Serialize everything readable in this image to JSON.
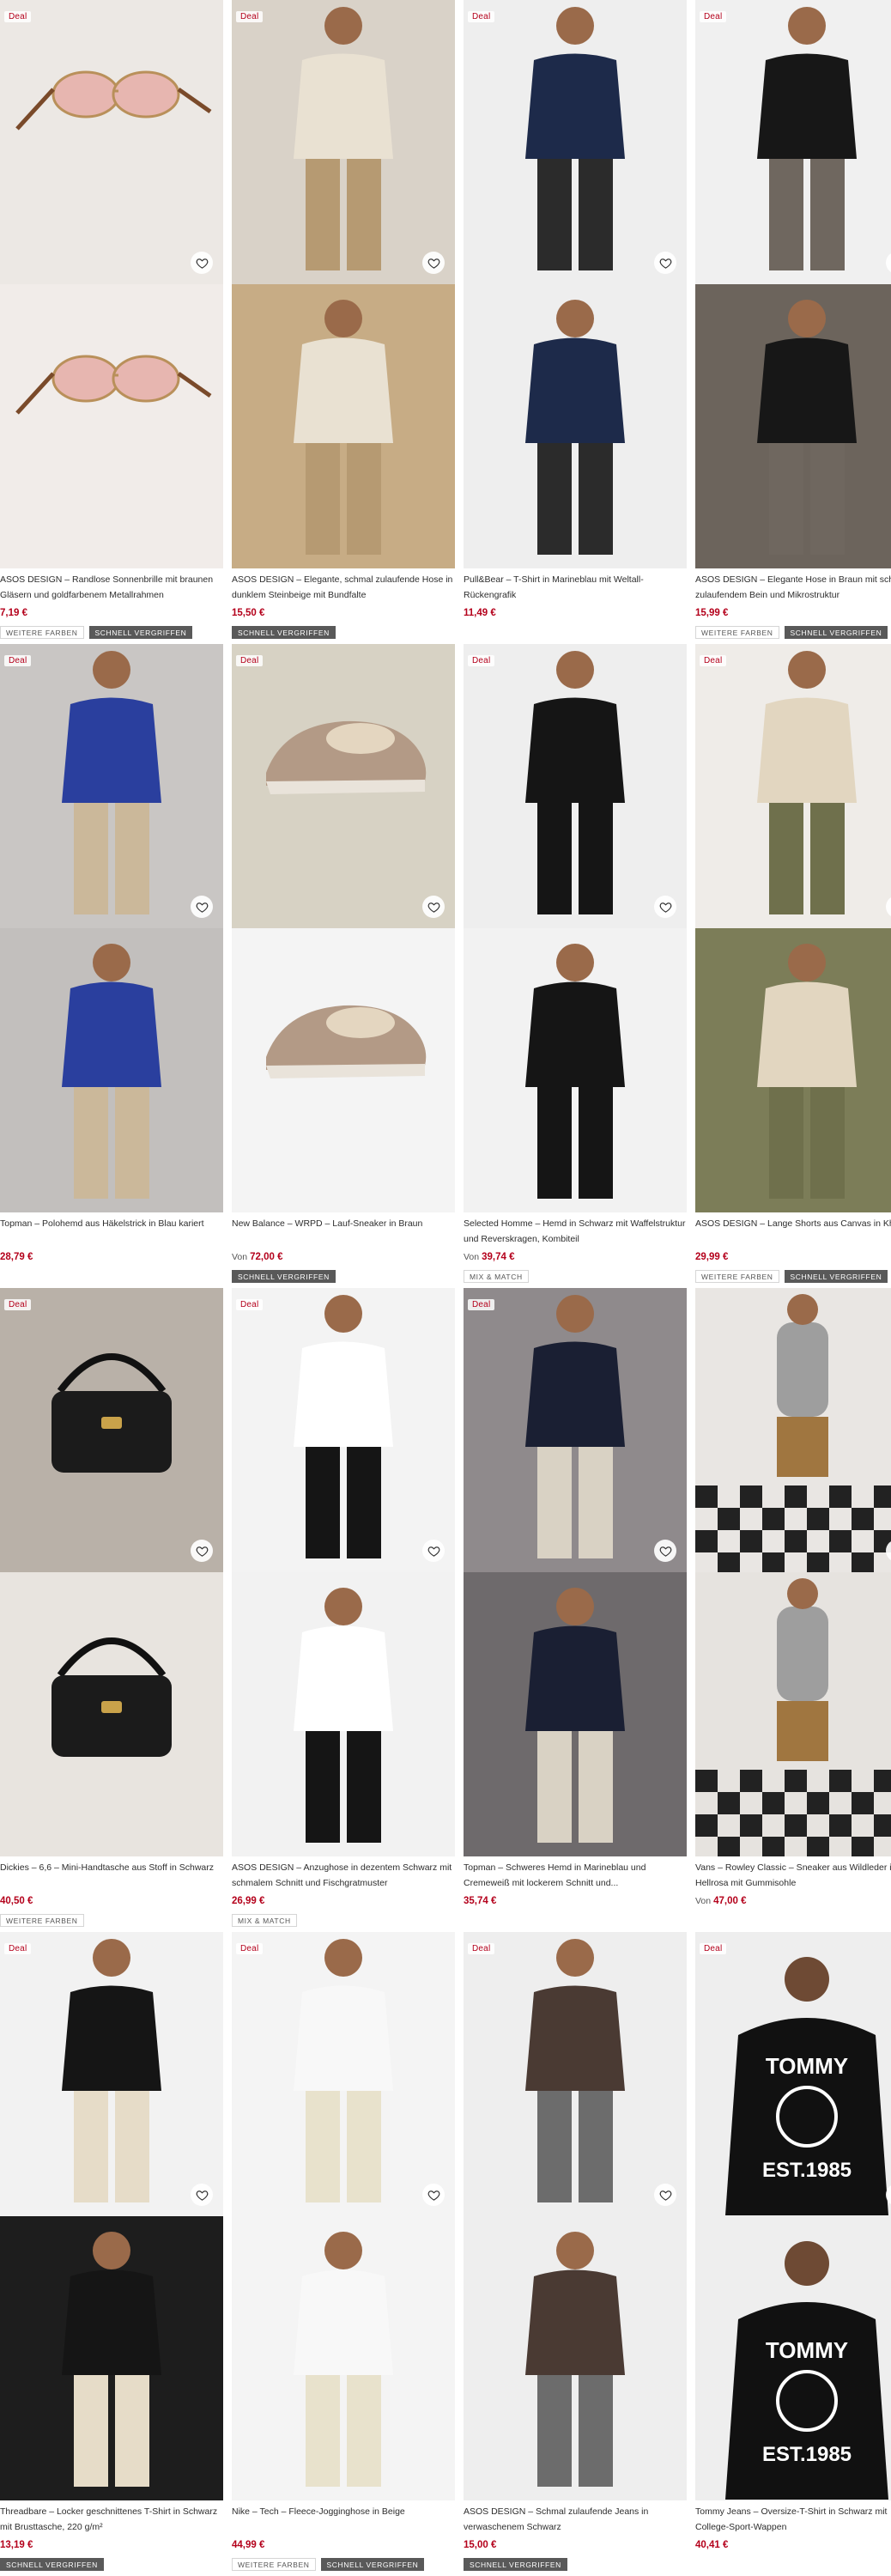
{
  "deal_label": "Deal",
  "colors": {
    "accent_price": "#b4001b",
    "badge_dark": "#595959"
  },
  "icons": {
    "wishlist": "heart-icon"
  },
  "products": [
    {
      "title": "ASOS DESIGN – Randlose Sonnenbrille mit braunen Gläsern und goldfarbenem Metallrahmen",
      "price": "7,19 €",
      "from": "",
      "deal": true,
      "badges": [
        {
          "label": "WEITERE FARBEN",
          "dark": false
        },
        {
          "label": "SCHNELL VERGRIFFEN",
          "dark": true
        }
      ],
      "top": "#ece8e4",
      "bottom": "#f1ece9",
      "figure": "sunglasses"
    },
    {
      "title": "ASOS DESIGN – Elegante, schmal zulaufende Hose in dunklem Steinbeige mit Bundfalte",
      "price": "15,50 €",
      "from": "",
      "deal": true,
      "badges": [
        {
          "label": "SCHNELL VERGRIFFEN",
          "dark": true
        }
      ],
      "top": "#d9d2c8",
      "bottom": "#c7ac85",
      "figure": "trousers"
    },
    {
      "title": "Pull&Bear – T-Shirt in Marineblau mit Weltall-Rückengrafik",
      "price": "11,49 €",
      "from": "",
      "deal": true,
      "badges": [],
      "top": "#eeeeee",
      "bottom": "#eeeeee",
      "figure": "navy-tee"
    },
    {
      "title": "ASOS DESIGN – Elegante Hose in Braun mit schmal zulaufendem Bein und Mikrostruktur",
      "price": "15,99 €",
      "from": "",
      "deal": true,
      "badges": [
        {
          "label": "WEITERE FARBEN",
          "dark": false
        },
        {
          "label": "SCHNELL VERGRIFFEN",
          "dark": true
        }
      ],
      "top": "#f0f0f0",
      "bottom": "#6c645c",
      "figure": "brown-trousers"
    },
    {
      "title": "Topman – Polohemd aus Häkelstrick in Blau kariert",
      "price": "28,79 €",
      "from": "",
      "deal": true,
      "badges": [],
      "top": "#c9c6c4",
      "bottom": "#c2bfbd",
      "figure": "blue-polo"
    },
    {
      "title": "New Balance – WRPD – Lauf-Sneaker in Braun",
      "price": "72,00 €",
      "from": "Von",
      "deal": true,
      "badges": [
        {
          "label": "SCHNELL VERGRIFFEN",
          "dark": true
        }
      ],
      "top": "#d7d2c4",
      "bottom": "#f4f4f4",
      "figure": "sneaker"
    },
    {
      "title": "Selected Homme – Hemd in Schwarz mit Waffelstruktur und Reverskragen, Kombiteil",
      "price": "39,74 €",
      "from": "Von",
      "deal": true,
      "badges": [
        {
          "label": "MIX & MATCH",
          "dark": false
        }
      ],
      "top": "#eeeeee",
      "bottom": "#f2f2f2",
      "figure": "black-shirt"
    },
    {
      "title": "ASOS DESIGN – Lange Shorts aus Canvas in Khaki",
      "price": "29,99 €",
      "from": "",
      "deal": true,
      "badges": [
        {
          "label": "WEITERE FARBEN",
          "dark": false
        },
        {
          "label": "SCHNELL VERGRIFFEN",
          "dark": true
        }
      ],
      "top": "#efece8",
      "bottom": "#7c7d58",
      "figure": "shorts"
    },
    {
      "title": "Dickies – 6,6 – Mini-Handtasche aus Stoff in Schwarz",
      "price": "40,50 €",
      "from": "",
      "deal": true,
      "badges": [
        {
          "label": "WEITERE FARBEN",
          "dark": false
        }
      ],
      "top": "#b9b1a8",
      "bottom": "#e8e4df",
      "figure": "handbag"
    },
    {
      "title": "ASOS DESIGN – Anzughose in dezentem Schwarz mit schmalem Schnitt und Fischgratmuster",
      "price": "26,99 €",
      "from": "",
      "deal": true,
      "badges": [
        {
          "label": "MIX & MATCH",
          "dark": false
        }
      ],
      "top": "#f3f3f3",
      "bottom": "#f2f2f2",
      "figure": "black-suit"
    },
    {
      "title": "Topman – Schweres Hemd in Marineblau und Cremeweiß mit lockerem Schnitt und...",
      "price": "35,74 €",
      "from": "",
      "deal": true,
      "badges": [],
      "top": "#8f8a8c",
      "bottom": "#6e6a6c",
      "figure": "paisley-shirt"
    },
    {
      "title": "Vans – Rowley Classic – Sneaker aus Wildleder in Hellrosa mit Gummisohle",
      "price": "47,00 €",
      "from": "Von",
      "deal": false,
      "badges": [],
      "top": "#e9e6e3",
      "bottom": "#e6e3df",
      "figure": "checker"
    },
    {
      "title": "Threadbare – Locker geschnittenes T-Shirt in Schwarz mit Brusttasche, 220 g/m²",
      "price": "13,19 €",
      "from": "",
      "deal": true,
      "badges": [
        {
          "label": "SCHNELL VERGRIFFEN",
          "dark": true
        }
      ],
      "top": "#f2f2f2",
      "bottom": "#1d1d1d",
      "figure": "black-tee"
    },
    {
      "title": "Nike – Tech – Fleece-Jogginghose in Beige",
      "price": "44,99 €",
      "from": "",
      "deal": true,
      "badges": [
        {
          "label": "WEITERE FARBEN",
          "dark": false
        },
        {
          "label": "SCHNELL VERGRIFFEN",
          "dark": true
        }
      ],
      "top": "#f4f4f4",
      "bottom": "#f4f4f4",
      "figure": "joggers"
    },
    {
      "title": "ASOS DESIGN – Schmal zulaufende Jeans in verwaschenem Schwarz",
      "price": "15,00 €",
      "from": "",
      "deal": true,
      "badges": [
        {
          "label": "SCHNELL VERGRIFFEN",
          "dark": true
        }
      ],
      "top": "#eeeeee",
      "bottom": "#eeeeee",
      "figure": "jeans"
    },
    {
      "title": "Tommy Jeans – Oversize-T-Shirt in Schwarz mit College-Sport-Wappen",
      "price": "40,41 €",
      "from": "",
      "deal": true,
      "badges": [],
      "top": "#eeeeee",
      "bottom": "#eeeeee",
      "figure": "tommy"
    }
  ]
}
